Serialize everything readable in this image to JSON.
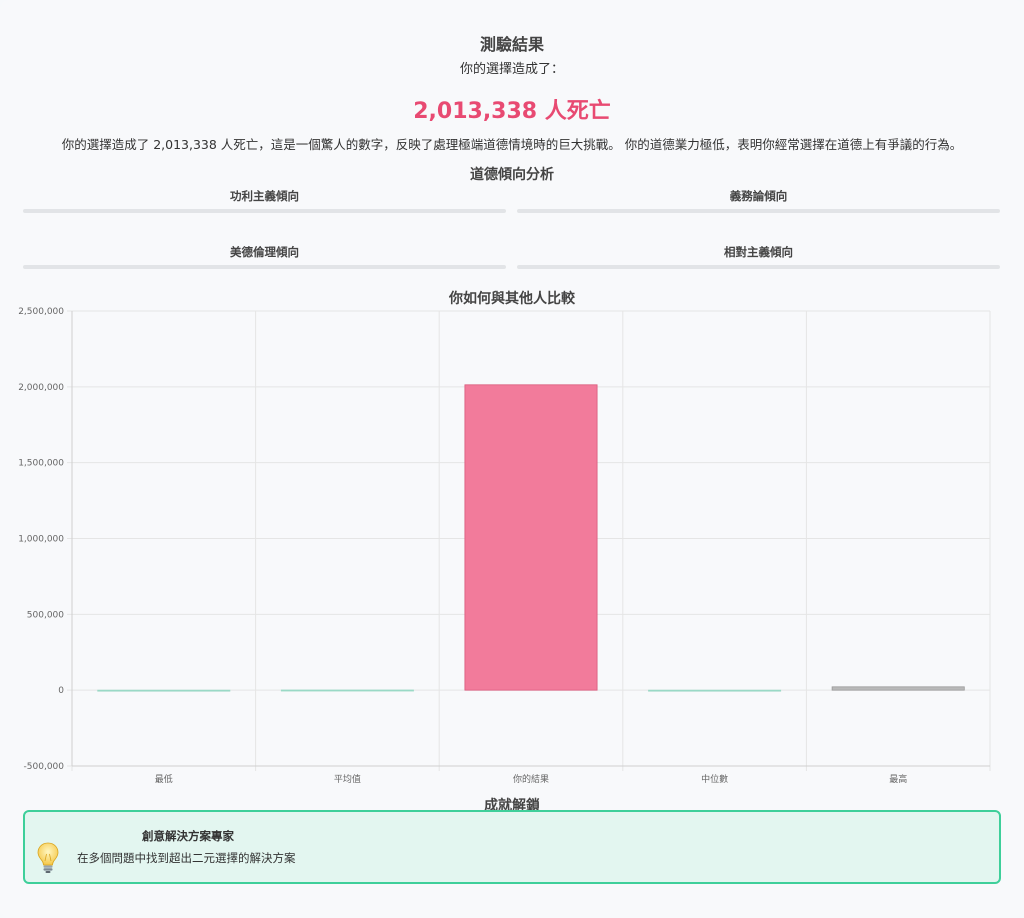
{
  "result": {
    "title": "測驗結果",
    "subtitle": "你的選擇造成了：",
    "deaths_text": "2,013,338 人死亡",
    "description": "你的選擇造成了 2,013,338 人死亡，這是一個驚人的數字，反映了處理極端道德情境時的巨大挑戰。 你的道德業力極低，表明你經常選擇在道德上有爭議的行為。"
  },
  "analysis": {
    "title": "道德傾向分析",
    "traits": [
      {
        "label": "功利主義傾向"
      },
      {
        "label": "義務論傾向"
      },
      {
        "label": "美德倫理傾向"
      },
      {
        "label": "相對主義傾向"
      }
    ]
  },
  "chart_data": {
    "type": "bar",
    "title": "你如何與其他人比較",
    "categories": [
      "最低",
      "平均值",
      "你的結果",
      "中位數",
      "最高"
    ],
    "values": [
      0,
      1000,
      2013338,
      0,
      22000
    ],
    "ylim": [
      -500000,
      2500000
    ],
    "yticks": [
      2500000,
      2000000,
      1500000,
      1000000,
      500000,
      0,
      -500000
    ],
    "ytick_labels": [
      "2,500,000",
      "2,000,000",
      "1,500,000",
      "1,000,000",
      "500,000",
      "0",
      "-500,000"
    ],
    "grid": true,
    "colors": {
      "你的結果": "#f27b9b",
      "最高": "#b9b9b9",
      "other": "#9bd9c6"
    }
  },
  "achievements": {
    "title": "成就解鎖",
    "items": [
      {
        "icon": "lightbulb-icon",
        "name": "創意解決方案專家",
        "description": "在多個問題中找到超出二元選擇的解決方案"
      }
    ]
  }
}
